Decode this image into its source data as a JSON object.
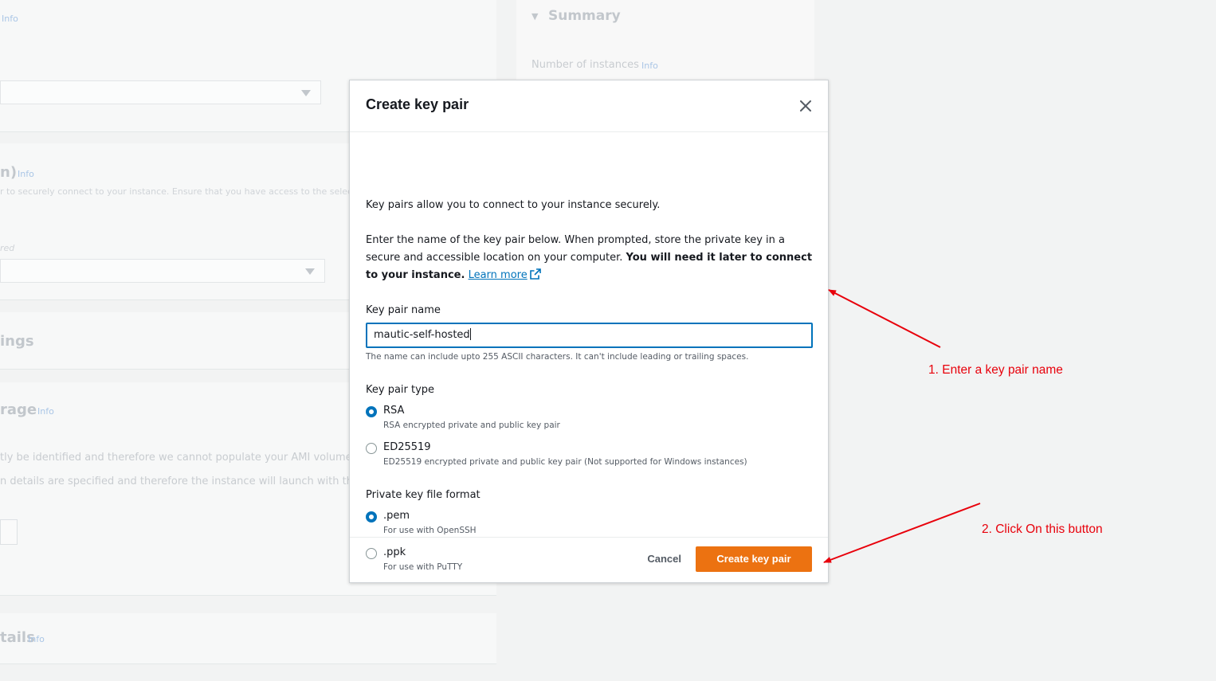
{
  "background": {
    "info_label": "Info",
    "summary": {
      "title": "Summary",
      "number_of_instances_label": "Number of instances",
      "info_label": "Info"
    },
    "key_pair_heading": "n)",
    "key_pair_desc": "r to securely connect to your instance. Ensure that you have access to the selected",
    "required_label": "red",
    "settings_heading": "ings",
    "storage_heading": "rage",
    "storage_line1": "tly be identified and therefore we cannot populate your AMI volumes",
    "storage_line2": "n details are specified and therefore the instance will launch with the A",
    "details_heading": "tails"
  },
  "modal": {
    "title": "Create key pair",
    "intro": "Key pairs allow you to connect to your instance securely.",
    "instructions_plain": "Enter the name of the key pair below. When prompted, store the private key in a secure and accessible location on your computer. ",
    "instructions_bold": "You will need it later to connect to your instance.",
    "learn_more": "Learn more",
    "key_pair_name_label": "Key pair name",
    "key_pair_name_value": "mautic-self-hosted",
    "key_pair_name_hint": "The name can include upto 255 ASCII characters. It can't include leading or trailing spaces.",
    "key_pair_type_label": "Key pair type",
    "key_pair_types": [
      {
        "label": "RSA",
        "description": "RSA encrypted private and public key pair",
        "selected": true
      },
      {
        "label": "ED25519",
        "description": "ED25519 encrypted private and public key pair (Not supported for Windows instances)",
        "selected": false
      }
    ],
    "file_format_label": "Private key file format",
    "file_formats": [
      {
        "label": ".pem",
        "description": "For use with OpenSSH",
        "selected": true
      },
      {
        "label": ".ppk",
        "description": "For use with PuTTY",
        "selected": false
      }
    ],
    "cancel_label": "Cancel",
    "create_label": "Create key pair"
  },
  "annotations": {
    "step1": "1. Enter a key pair name",
    "step2": "2. Click On this button"
  },
  "colors": {
    "accent": "#0073bb",
    "primary_button": "#ec7211",
    "annotation": "#e8000b"
  }
}
